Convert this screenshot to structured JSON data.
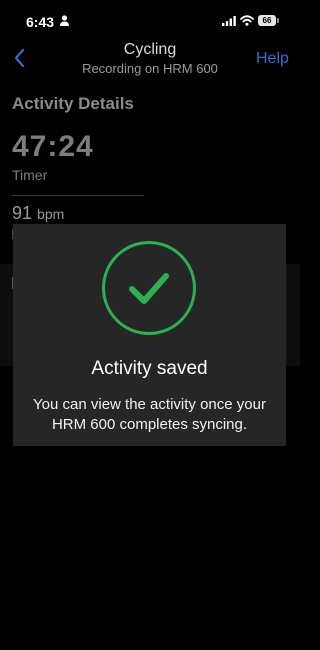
{
  "status_bar": {
    "time": "6:43",
    "battery": "66"
  },
  "nav": {
    "title": "Cycling",
    "subtitle": "Recording on HRM 600",
    "help": "Help"
  },
  "activity": {
    "section_title": "Activity Details",
    "timer_value": "47:24",
    "timer_label": "Timer",
    "heart_rate_value": "91",
    "heart_rate_unit": "bpm"
  },
  "modal": {
    "title": "Activity saved",
    "message": "You can view the activity once your HRM 600 completes syncing."
  },
  "colors": {
    "success": "#2bb24c",
    "link": "#2f6fd1",
    "modal_bg": "#262626"
  }
}
